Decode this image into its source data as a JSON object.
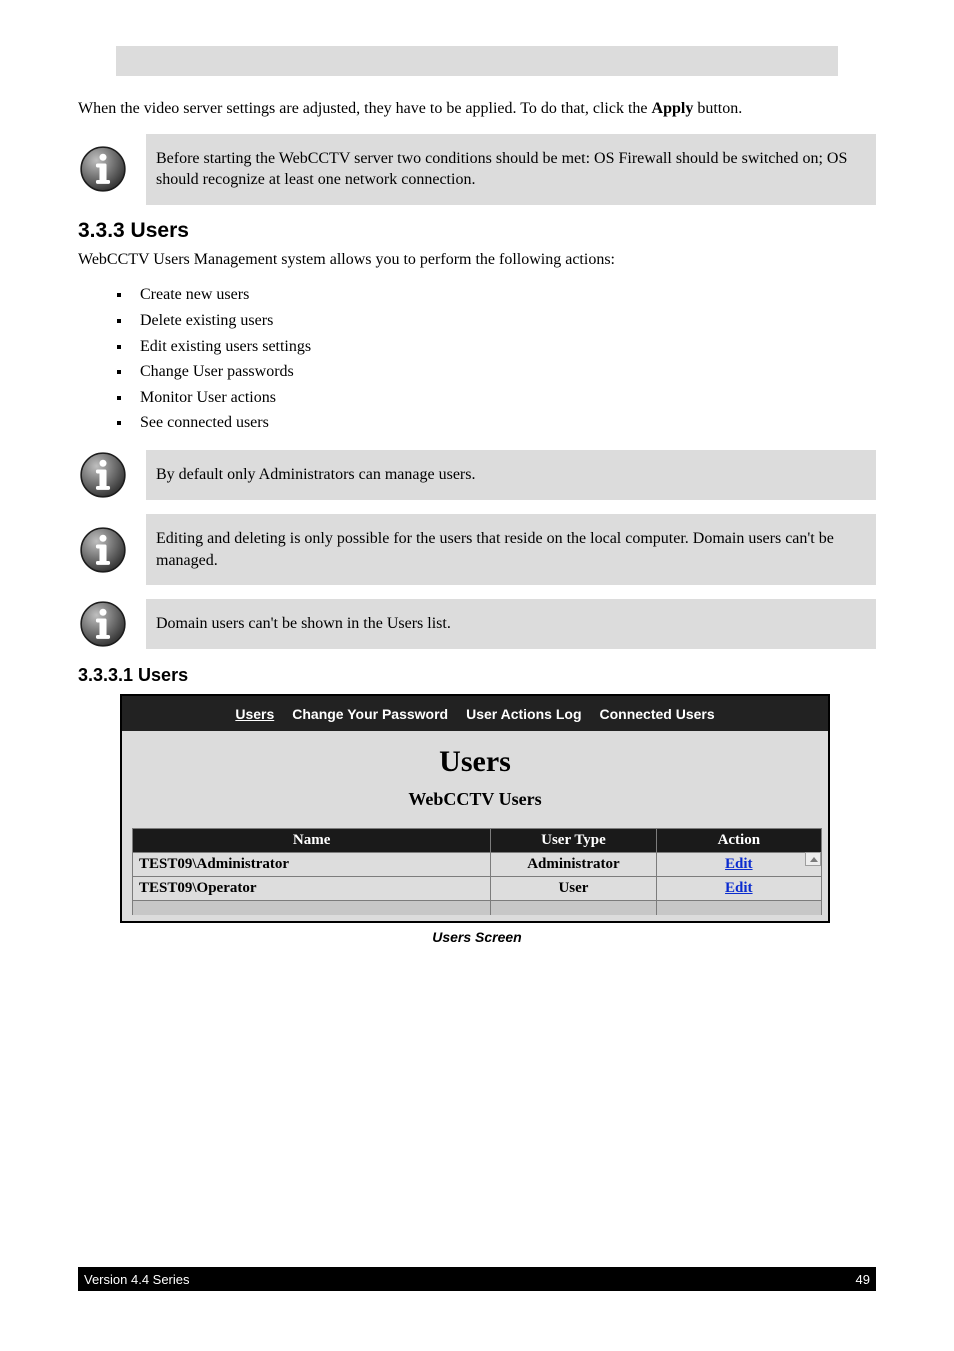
{
  "header_1": "",
  "header_2": "",
  "body_para": "When the video server settings are adjusted, they have to be applied. To do that, click the ",
  "apply_word": "Apply",
  "body_para_2": " button.",
  "note_before": "Before starting the WebCCTV server two conditions should be met: OS Firewall should be switched on; OS should recognize at least one network connection.",
  "heading_3_3_3": "3.3.3 Users",
  "intro_p": "WebCCTV Users Management system allows you to perform the following actions:",
  "features": [
    "Create new users",
    "Delete existing users",
    "Edit existing users settings",
    "Change User passwords",
    "Monitor User actions",
    "See connected users"
  ],
  "note_admin": "By default only Administrators can manage users.",
  "note_edit_del": "Editing and deleting is only possible for the users that reside on the local computer. Domain users can't be managed.",
  "note_domain": "Domain users can't be shown in the Users list.",
  "heading_3_3_3_1": "3.3.3.1 Users",
  "ui": {
    "navbar": [
      {
        "label": "Users",
        "active": true
      },
      {
        "label": "Change Your Password",
        "active": false
      },
      {
        "label": "User Actions Log",
        "active": false
      },
      {
        "label": "Connected Users",
        "active": false
      }
    ],
    "title": "Users",
    "subtitle": "WebCCTV Users",
    "columns": [
      "Name",
      "User Type",
      "Action"
    ],
    "rows": [
      {
        "name": "TEST09\\Administrator",
        "type": "Administrator",
        "action": "Edit"
      },
      {
        "name": "TEST09\\Operator",
        "type": "User",
        "action": "Edit"
      }
    ]
  },
  "caption": "Users Screen",
  "footer_version": "Version 4.4 Series",
  "footer_page": "49"
}
